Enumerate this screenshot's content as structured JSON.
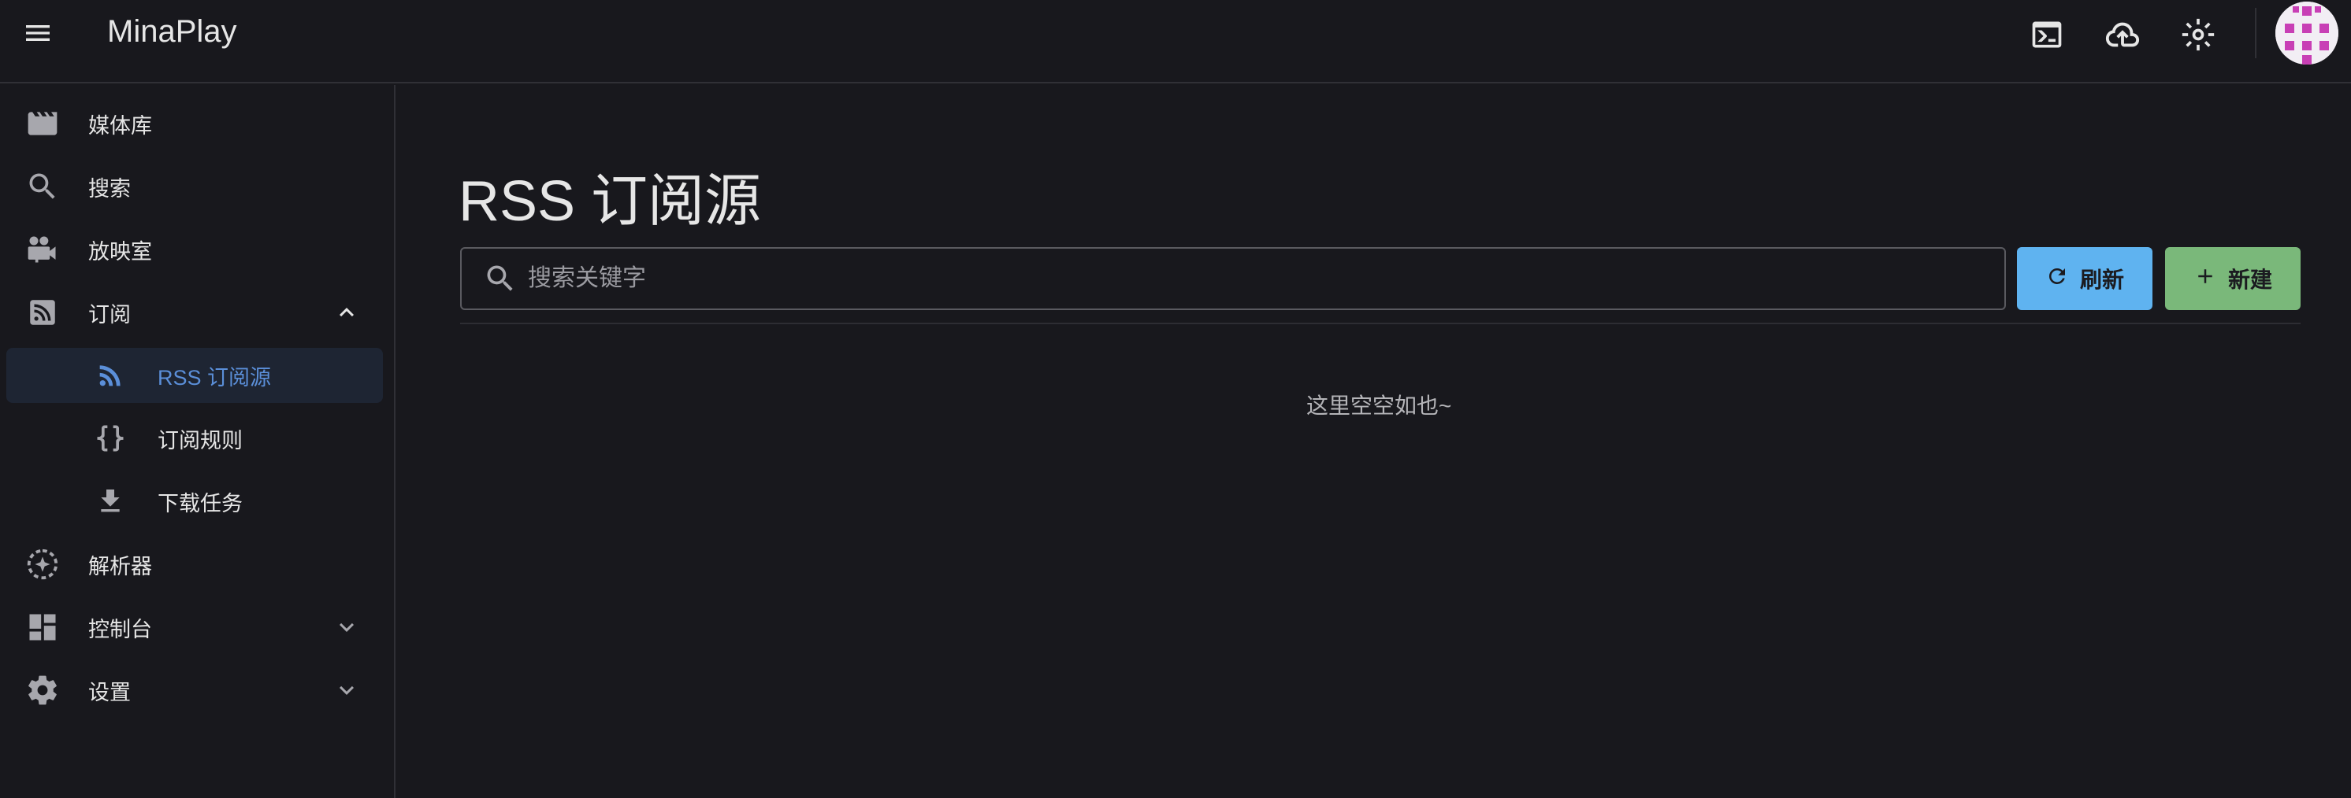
{
  "header": {
    "title": "MinaPlay",
    "icons": [
      "menu-icon",
      "terminal-icon",
      "cloud-upload-icon",
      "brightness-icon",
      "avatar"
    ]
  },
  "sidebar": {
    "items": [
      {
        "label": "媒体库",
        "icon": "movie-clapper-icon"
      },
      {
        "label": "搜索",
        "icon": "search-icon"
      },
      {
        "label": "放映室",
        "icon": "video-camera-icon"
      },
      {
        "label": "订阅",
        "icon": "rss-box-icon",
        "expanded": true
      },
      {
        "label": "RSS 订阅源",
        "icon": "rss-icon",
        "active": true
      },
      {
        "label": "订阅规则",
        "icon": "code-braces-icon"
      },
      {
        "label": "下载任务",
        "icon": "download-icon"
      },
      {
        "label": "解析器",
        "icon": "parser-icon"
      },
      {
        "label": "控制台",
        "icon": "dashboard-icon",
        "expanded": false
      },
      {
        "label": "设置",
        "icon": "gear-icon",
        "expanded": false
      }
    ]
  },
  "main": {
    "title": "RSS 订阅源",
    "search": {
      "placeholder": "搜索关键字",
      "value": ""
    },
    "refresh_label": "刷新",
    "create_label": "新建",
    "empty_text": "这里空空如也~"
  },
  "colors": {
    "background": "#18181d",
    "active_text": "#5b8fd9",
    "active_bg": "#1e2533",
    "refresh_button": "#5fb3f0",
    "create_button": "#7ab87a"
  }
}
